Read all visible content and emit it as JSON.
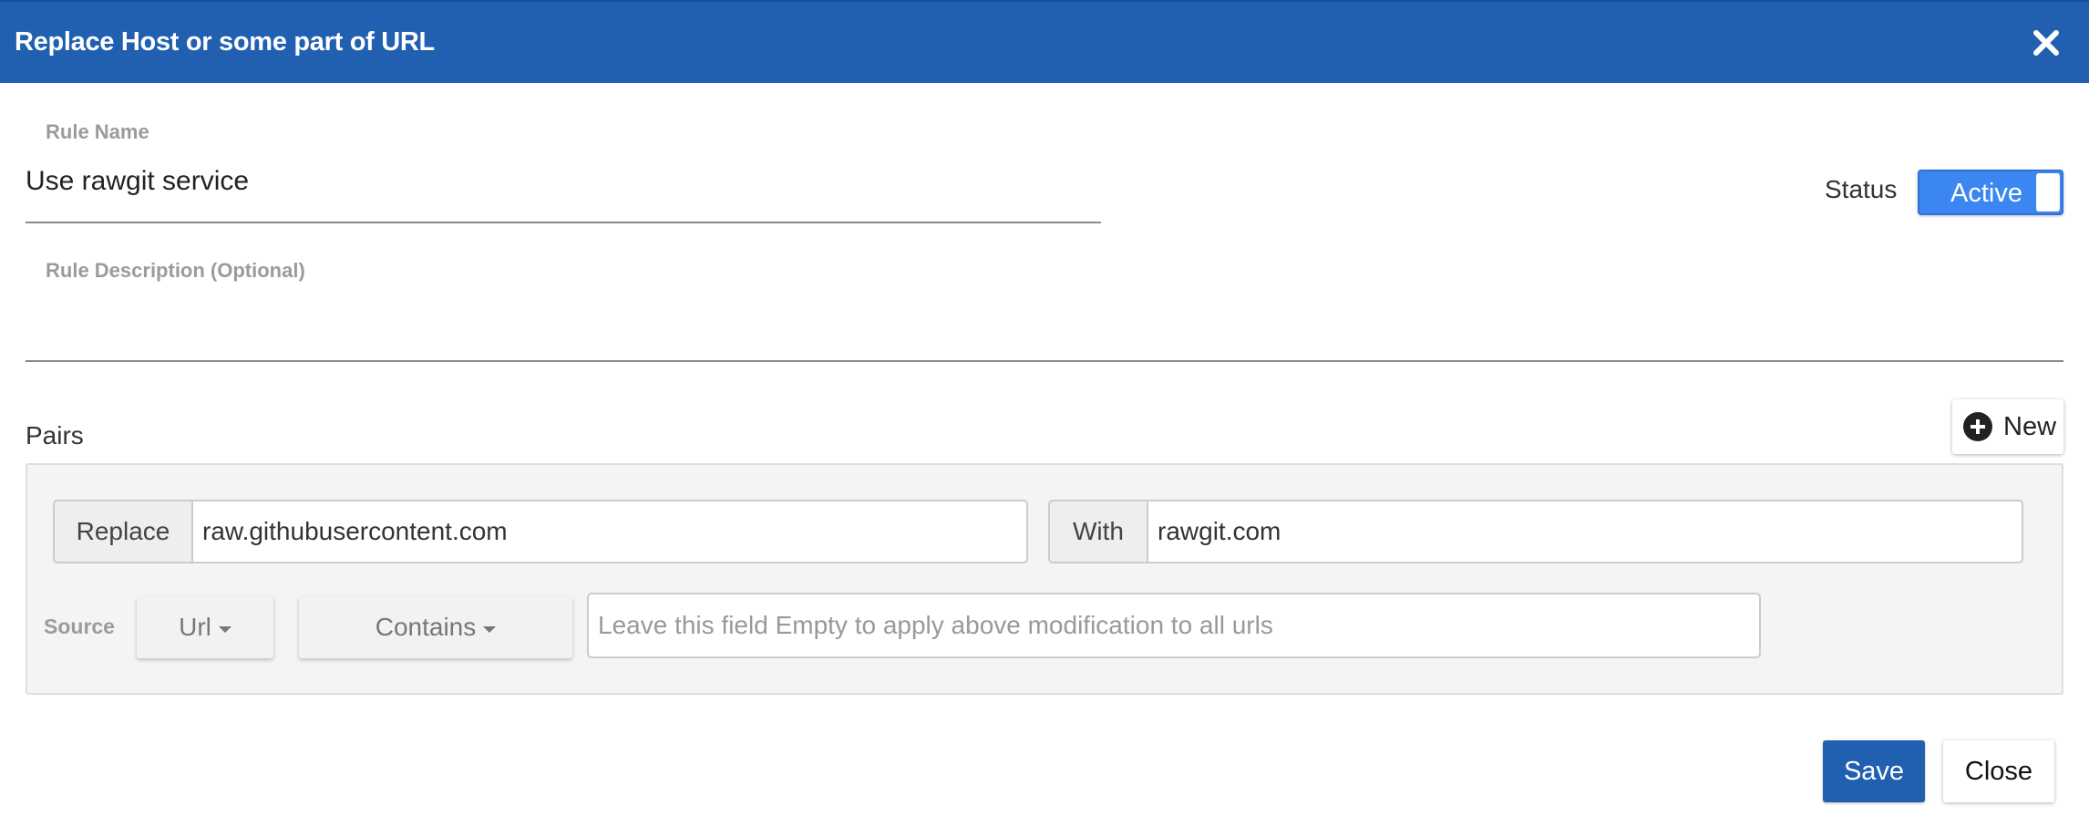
{
  "dialog": {
    "title": "Replace Host or some part of URL",
    "close_icon": "close-icon"
  },
  "rule": {
    "name_label": "Rule Name",
    "name_value": "Use rawgit service",
    "description_label": "Rule Description (Optional)",
    "description_value": "",
    "status_label": "Status",
    "status_value": "Active"
  },
  "pairs": {
    "label": "Pairs",
    "new_button": "New",
    "new_icon": "plus-circle-icon",
    "items": [
      {
        "replace_label": "Replace",
        "replace_value": "raw.githubusercontent.com",
        "with_label": "With",
        "with_value": "rawgit.com",
        "source_label": "Source",
        "source_key": "Url",
        "source_operator": "Contains",
        "source_value": "",
        "source_placeholder": "Leave this field Empty to apply above modification to all urls"
      }
    ]
  },
  "footer": {
    "save_label": "Save",
    "close_label": "Close"
  },
  "colors": {
    "header_bg": "#2160b0",
    "toggle_active": "#3b86f0",
    "save_bg": "#2160b0"
  }
}
